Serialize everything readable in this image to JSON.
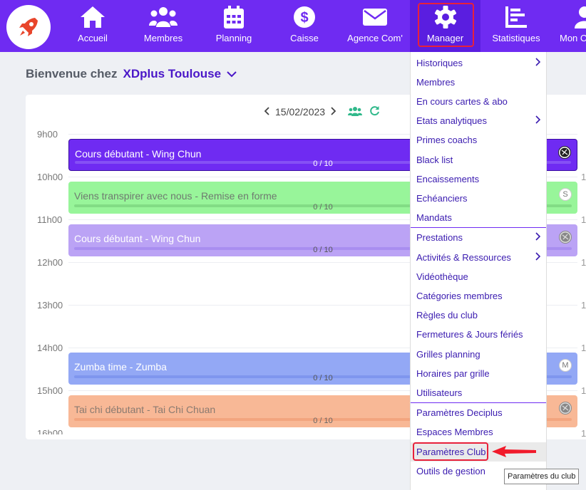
{
  "nav": {
    "items": [
      {
        "label": "Accueil",
        "icon": "home-icon"
      },
      {
        "label": "Membres",
        "icon": "users-icon"
      },
      {
        "label": "Planning",
        "icon": "calendar-icon"
      },
      {
        "label": "Caisse",
        "icon": "dollar-icon"
      },
      {
        "label": "Agence Com'",
        "icon": "envelope-icon"
      },
      {
        "label": "Manager",
        "icon": "gear-icon"
      },
      {
        "label": "Statistiques",
        "icon": "chart-icon"
      },
      {
        "label": "Mon C",
        "icon": "user-icon"
      }
    ],
    "active": "Manager",
    "colors": {
      "bar": "#6f2bf2",
      "active": "#5a1ee0",
      "highlight": "#e8213a"
    }
  },
  "welcome": {
    "prefix": "Bienvenue chez",
    "club": "XDplus Toulouse"
  },
  "planning": {
    "date": "15/02/2023",
    "hours": [
      "9h00",
      "10h00",
      "11h00",
      "12h00",
      "13h00",
      "14h00",
      "15h00",
      "16h00"
    ],
    "right_hours": [
      "1",
      "1",
      "1",
      "1",
      "1",
      "1",
      "1"
    ],
    "events": [
      {
        "title": "Cours débutant - Wing Chun",
        "count": "0 / 10",
        "avatar": "",
        "color": "#6f2bf2"
      },
      {
        "title": "Viens transpirer avec nous - Remise en forme",
        "count": "0 / 10",
        "avatar": "S",
        "color": "#98f59a"
      },
      {
        "title": "Cours débutant - Wing Chun",
        "count": "0 / 10",
        "avatar": "",
        "color": "#bba3f5"
      },
      {
        "title": "Zumba time - Zumba",
        "count": "0 / 10",
        "avatar": "M",
        "color": "#93a8f5"
      },
      {
        "title": "Tai chi débutant - Tai Chi Chuan",
        "count": "0 / 10",
        "avatar": "",
        "color": "#f8b896"
      }
    ]
  },
  "menu": {
    "items": [
      {
        "label": "Historiques",
        "submenu": true
      },
      {
        "label": "Membres",
        "submenu": false
      },
      {
        "label": "En cours cartes & abo",
        "submenu": false
      },
      {
        "label": "Etats analytiques",
        "submenu": true
      },
      {
        "label": "Primes coachs",
        "submenu": false
      },
      {
        "label": "Black list",
        "submenu": false
      },
      {
        "label": "Encaissements",
        "submenu": false
      },
      {
        "label": "Echéanciers",
        "submenu": false
      },
      {
        "label": "Mandats",
        "submenu": false
      },
      {
        "label": "Prestations",
        "submenu": true
      },
      {
        "label": "Activités & Ressources",
        "submenu": true
      },
      {
        "label": "Vidéothèque",
        "submenu": false
      },
      {
        "label": "Catégories membres",
        "submenu": false
      },
      {
        "label": "Règles du club",
        "submenu": false
      },
      {
        "label": "Fermetures & Jours fériés",
        "submenu": false
      },
      {
        "label": "Grilles planning",
        "submenu": false
      },
      {
        "label": "Horaires par grille",
        "submenu": false
      },
      {
        "label": "Utilisateurs",
        "submenu": false
      },
      {
        "label": "Paramètres Deciplus",
        "submenu": false
      },
      {
        "label": "Espaces Membres",
        "submenu": false
      },
      {
        "label": "Paramètres Club",
        "submenu": false
      },
      {
        "label": "Outils de gestion",
        "submenu": false
      }
    ],
    "highlighted": "Paramètres Club"
  },
  "tooltip": "Paramètres du club"
}
